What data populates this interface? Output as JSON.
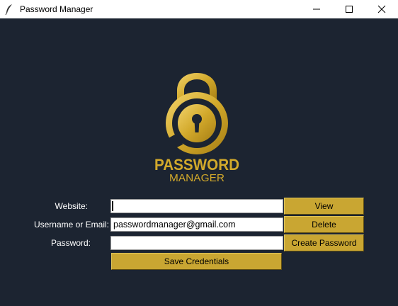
{
  "window": {
    "title": "Password Manager",
    "icon": "feather-icon",
    "controls": [
      "minimize-icon",
      "maximize-icon",
      "close-icon"
    ]
  },
  "logo": {
    "word1": "PASSWORD",
    "word2": "MANAGER",
    "accent_color": "#d2a92b",
    "icon": "padlock-icon"
  },
  "form": {
    "website_label": "Website:",
    "website_value": "",
    "username_label": "Username or Email:",
    "username_value": "passwordmanager@gmail.com",
    "password_label": "Password:",
    "password_value": ""
  },
  "buttons": {
    "view": "View",
    "delete": "Delete",
    "create_password": "Create Password",
    "save": "Save Credentials"
  },
  "colors": {
    "background": "#1c2431",
    "button": "#c9a632"
  }
}
